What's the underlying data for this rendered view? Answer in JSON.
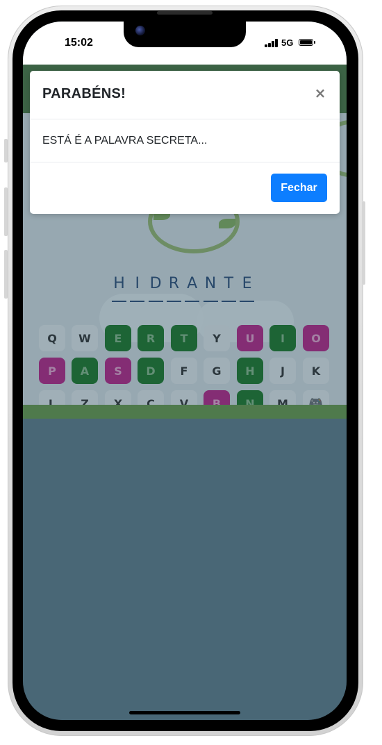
{
  "status_bar": {
    "time": "15:02",
    "network": "5G",
    "icons": [
      "signal-icon",
      "battery-icon"
    ]
  },
  "modal": {
    "title": "PARABÉNS!",
    "close_symbol": "×",
    "message": "ESTÁ É A PALAVRA SECRETA...",
    "button_label": "Fechar"
  },
  "game": {
    "secret_word": [
      "H",
      "I",
      "D",
      "R",
      "A",
      "N",
      "T",
      "E"
    ],
    "keyboard": [
      [
        {
          "label": "Q",
          "state": "neutral"
        },
        {
          "label": "W",
          "state": "neutral"
        },
        {
          "label": "E",
          "state": "correct"
        },
        {
          "label": "R",
          "state": "correct"
        },
        {
          "label": "T",
          "state": "correct"
        },
        {
          "label": "Y",
          "state": "neutral"
        },
        {
          "label": "U",
          "state": "wrong"
        },
        {
          "label": "I",
          "state": "correct"
        },
        {
          "label": "O",
          "state": "wrong"
        }
      ],
      [
        {
          "label": "P",
          "state": "wrong"
        },
        {
          "label": "A",
          "state": "correct"
        },
        {
          "label": "S",
          "state": "wrong"
        },
        {
          "label": "D",
          "state": "correct"
        },
        {
          "label": "F",
          "state": "neutral"
        },
        {
          "label": "G",
          "state": "neutral"
        },
        {
          "label": "H",
          "state": "correct"
        },
        {
          "label": "J",
          "state": "neutral"
        },
        {
          "label": "K",
          "state": "neutral"
        }
      ],
      [
        {
          "label": "L",
          "state": "neutral"
        },
        {
          "label": "Z",
          "state": "neutral"
        },
        {
          "label": "X",
          "state": "neutral"
        },
        {
          "label": "C",
          "state": "neutral"
        },
        {
          "label": "V",
          "state": "neutral"
        },
        {
          "label": "B",
          "state": "wrong"
        },
        {
          "label": "N",
          "state": "correct"
        },
        {
          "label": "M",
          "state": "neutral"
        },
        {
          "label": "🎮",
          "state": "neutral",
          "icon": "gamepad-icon"
        }
      ]
    ]
  },
  "colors": {
    "correct": "#0b6b15",
    "wrong": "#b0127b",
    "primary_button": "#0d7eff",
    "background": "#51707f"
  }
}
